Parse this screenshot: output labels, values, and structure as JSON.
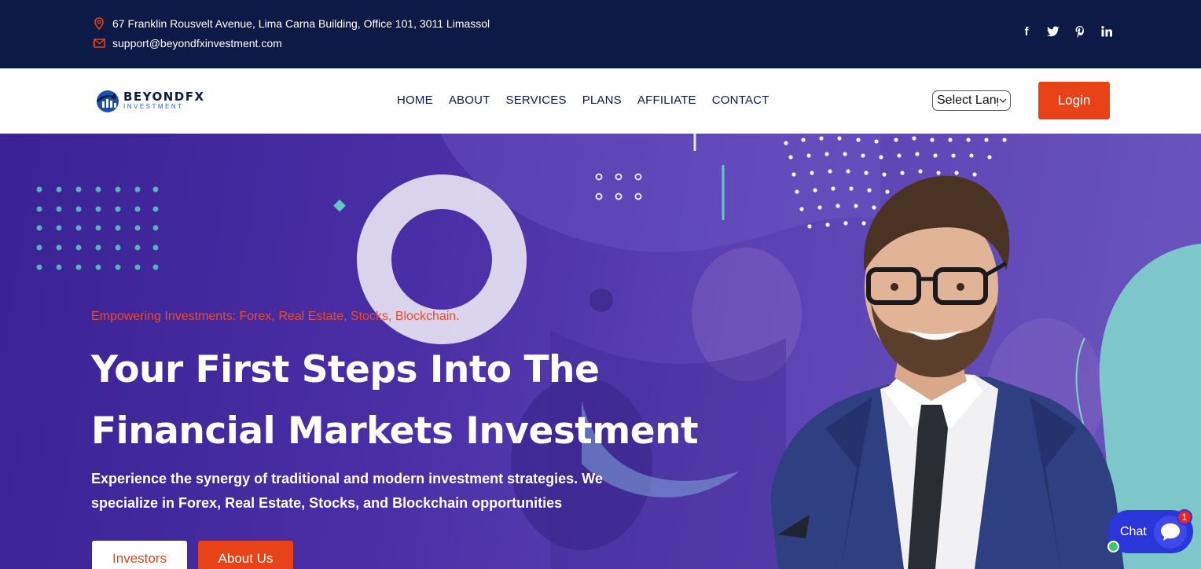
{
  "colors": {
    "topbar_bg": "#0c1a45",
    "accent": "#e84219",
    "hero_purple": "#4a2ea6",
    "chat_blue": "#2b36d9"
  },
  "topbar": {
    "address": "67 Franklin Rousvelt Avenue, Lima Carna Building, Office 101, 3011 Limassol",
    "email": "support@beyondfxinvestment.com",
    "address_icon": "location-pin-icon",
    "email_icon": "envelope-icon",
    "socials": [
      "facebook-icon",
      "twitter-icon",
      "pinterest-icon",
      "linkedin-icon"
    ]
  },
  "nav": {
    "logo_name": "BEYONDFX",
    "logo_sub": "INVESTMENT",
    "menu": [
      {
        "label": "HOME"
      },
      {
        "label": "ABOUT"
      },
      {
        "label": "SERVICES"
      },
      {
        "label": "PLANS"
      },
      {
        "label": "AFFILIATE"
      },
      {
        "label": "CONTACT"
      }
    ],
    "language_select": "Select Language",
    "login_label": "Login"
  },
  "hero": {
    "tagline": "Empowering Investments: Forex, Real Estate, Stocks, Blockchain.",
    "headline_line1": "Your First Steps Into The",
    "headline_line2": "Financial Markets Investment",
    "subtext": "Experience the synergy of traditional and modern investment strategies. We specialize in Forex, Real Estate, Stocks, and Blockchain opportunities",
    "btn_investors": "Investors",
    "btn_about": "About Us"
  },
  "chat": {
    "label": "Chat",
    "badge_count": "1"
  }
}
